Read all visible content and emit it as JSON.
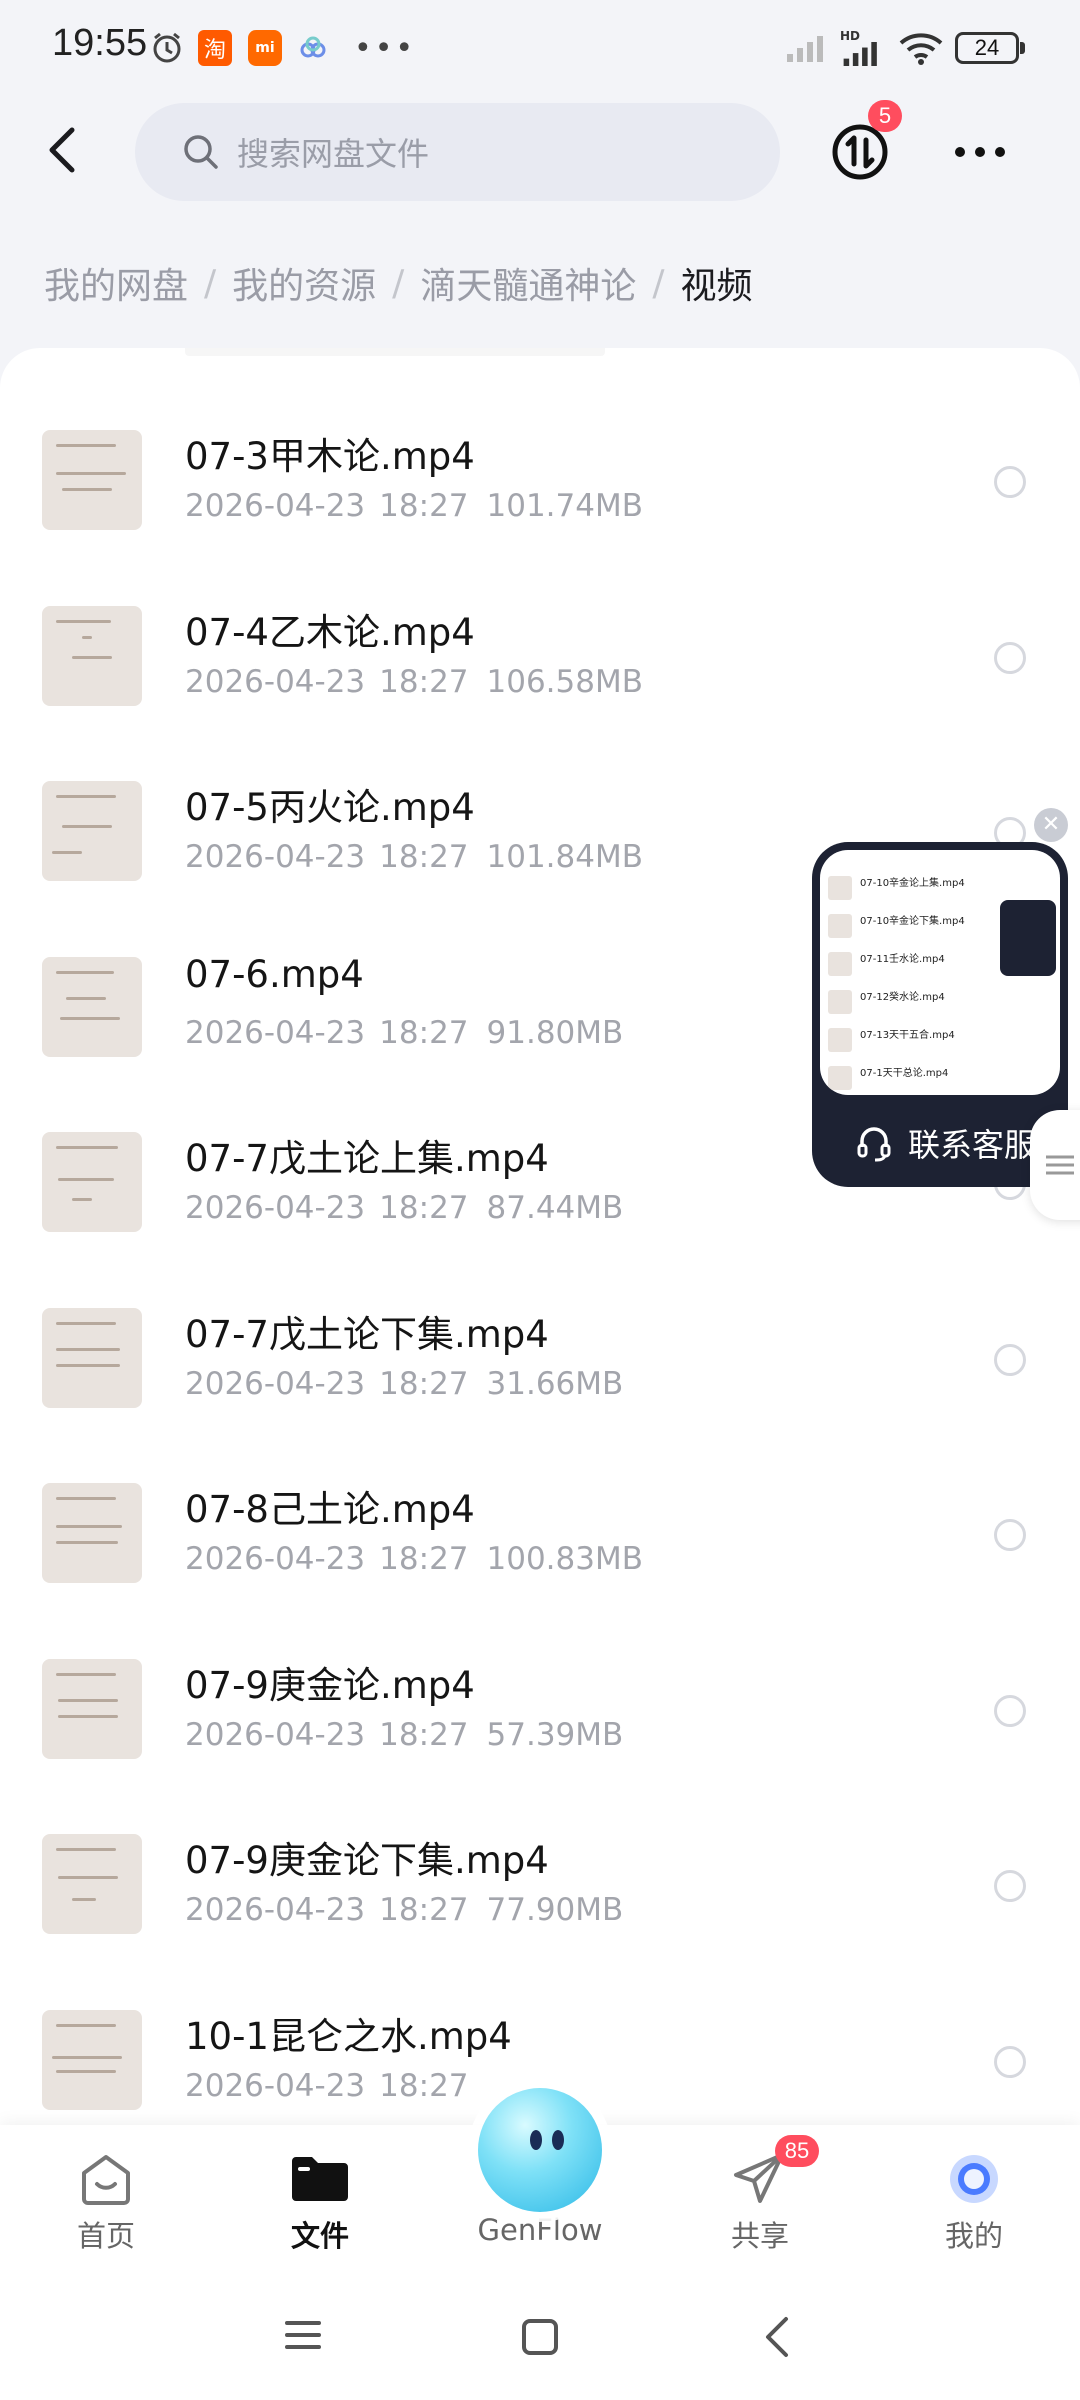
{
  "status_bar": {
    "time": "19:55",
    "battery": "24",
    "network_label": "HD",
    "app_icons": [
      "alarm-icon",
      "taobao-app-icon",
      "mi-app-icon",
      "cloud-app-icon",
      "more-dots-icon"
    ]
  },
  "header": {
    "search_placeholder": "搜索网盘文件",
    "transfer_badge": "5"
  },
  "breadcrumb": {
    "items": [
      "我的网盘",
      "我的资源",
      "滴天髓通神论"
    ],
    "current": "视频"
  },
  "files": [
    {
      "name": "07-3甲木论.mp4",
      "date": "2026-04-23",
      "time": "18:27",
      "size": "101.74MB"
    },
    {
      "name": "07-4乙木论.mp4",
      "date": "2026-04-23",
      "time": "18:27",
      "size": "106.58MB"
    },
    {
      "name": "07-5丙火论.mp4",
      "date": "2026-04-23",
      "time": "18:27",
      "size": "101.84MB"
    },
    {
      "name": "07-6.mp4",
      "date": "2026-04-23",
      "time": "18:27",
      "size": "91.80MB"
    },
    {
      "name": "07-7戊土论上集.mp4",
      "date": "2026-04-23",
      "time": "18:27",
      "size": "87.44MB"
    },
    {
      "name": "07-7戊土论下集.mp4",
      "date": "2026-04-23",
      "time": "18:27",
      "size": "31.66MB"
    },
    {
      "name": "07-8己土论.mp4",
      "date": "2026-04-23",
      "time": "18:27",
      "size": "100.83MB"
    },
    {
      "name": "07-9庚金论.mp4",
      "date": "2026-04-23",
      "time": "18:27",
      "size": "57.39MB"
    },
    {
      "name": "07-9庚金论下集.mp4",
      "date": "2026-04-23",
      "time": "18:27",
      "size": "77.90MB"
    },
    {
      "name": "10-1昆仑之水.mp4",
      "date": "2026-04-23",
      "time": "18:27",
      "size": ""
    }
  ],
  "floating_service": {
    "label": "联系客服",
    "preview_rows": [
      "07-10辛金论上集.mp4",
      "07-10辛金论下集.mp4",
      "07-11壬水论.mp4",
      "07-12癸水论.mp4",
      "07-13天干五合.mp4",
      "07-1天干总论.mp4"
    ]
  },
  "bottom_nav": {
    "items": [
      {
        "label": "首页",
        "icon": "home-icon"
      },
      {
        "label": "文件",
        "icon": "folder-icon"
      },
      {
        "label": "GenFlow",
        "icon": "genflow-icon"
      },
      {
        "label": "共享",
        "icon": "share-plane-icon",
        "badge": "85"
      },
      {
        "label": "我的",
        "icon": "profile-icon"
      }
    ],
    "active": "文件"
  },
  "colors": {
    "background": "#f3f4f8",
    "badge": "#ff4d5e",
    "secondary_text": "#a3a5ac",
    "float_bg": "#1d2233"
  }
}
